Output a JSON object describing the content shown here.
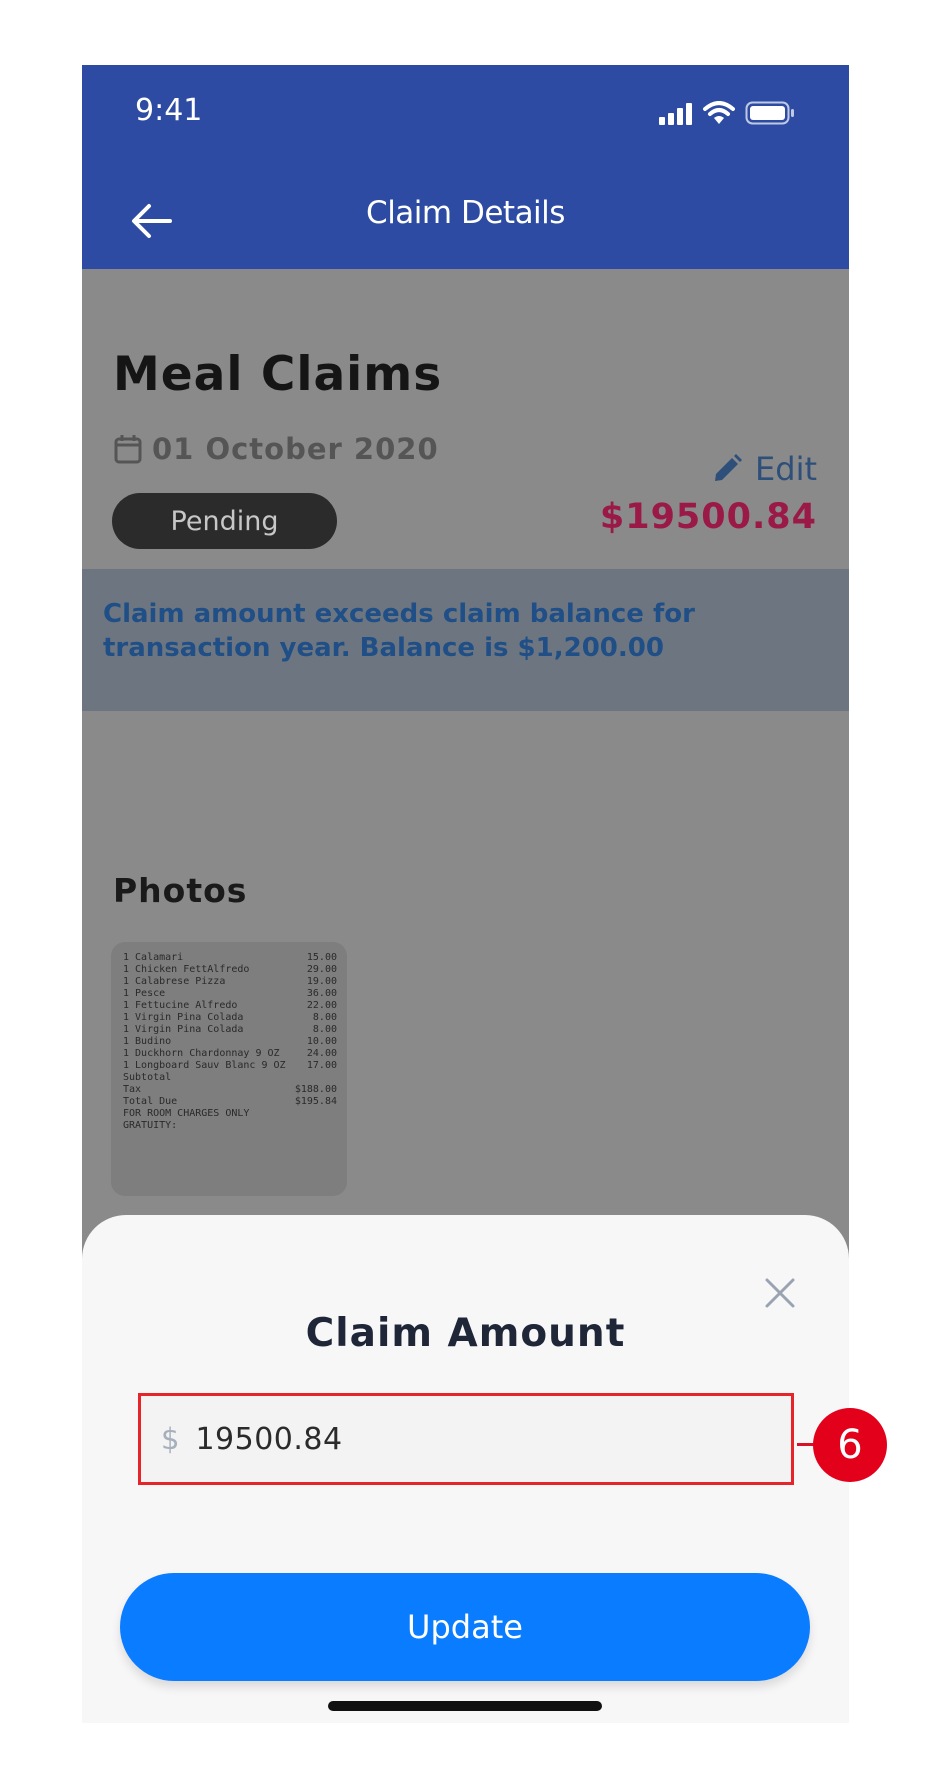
{
  "status_bar": {
    "time": "9:41"
  },
  "header": {
    "title": "Claim Details"
  },
  "claim": {
    "title": "Meal Claims",
    "date": "01 October 2020",
    "status": "Pending",
    "edit_label": "Edit",
    "amount": "$19500.84"
  },
  "warning": {
    "message": "Claim amount exceeds claim balance for transaction year. Balance is $1,200.00"
  },
  "photos": {
    "label": "Photos",
    "receipt_lines": [
      [
        "1 Calamari",
        "15.00"
      ],
      [
        "1 Chicken FettAlfredo",
        "29.00"
      ],
      [
        "1 Calabrese Pizza",
        "19.00"
      ],
      [
        "1 Pesce",
        "36.00"
      ],
      [
        "1 Fettucine Alfredo",
        "22.00"
      ],
      [
        "1 Virgin Pina Colada",
        "8.00"
      ],
      [
        "1 Virgin Pina Colada",
        "8.00"
      ],
      [
        "1 Budino",
        "10.00"
      ],
      [
        "1 Duckhorn Chardonnay 9 OZ",
        "24.00"
      ],
      [
        "1 Longboard Sauv Blanc 9 OZ",
        "17.00"
      ],
      [
        "Subtotal",
        ""
      ],
      [
        "Tax",
        "$188.00"
      ],
      [
        "Total Due",
        "$195.84"
      ],
      [
        "FOR ROOM CHARGES ONLY",
        ""
      ],
      [
        "GRATUITY:",
        ""
      ]
    ]
  },
  "sheet": {
    "title": "Claim Amount",
    "currency_symbol": "$",
    "amount_value": "19500.84",
    "update_label": "Update"
  },
  "annotation": {
    "number": "6"
  },
  "colors": {
    "header_bg": "#2d4ba2",
    "amount": "#9a1946",
    "update_button": "#0a7cff",
    "highlight_border": "#e8242b"
  }
}
